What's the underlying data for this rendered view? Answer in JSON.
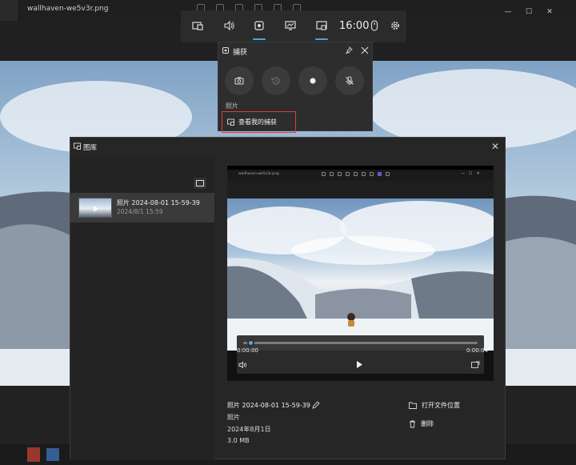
{
  "viewer": {
    "filename": "wallhaven-we5v3r.png",
    "window_controls": [
      "—",
      "☐",
      "✕"
    ]
  },
  "gamebar": {
    "clock": "16:00",
    "widgets": [
      {
        "icon": "widget-menu-icon",
        "active": false
      },
      {
        "icon": "audio-icon",
        "active": false
      },
      {
        "icon": "capture-icon",
        "active": true
      },
      {
        "icon": "performance-icon",
        "active": false
      },
      {
        "icon": "gallery-icon",
        "active": true
      }
    ]
  },
  "capture": {
    "title": "捕获",
    "section_label": "照片",
    "gallery_link": "查看我的捕获"
  },
  "gallery": {
    "title": "图库",
    "items": [
      {
        "name": "照片 2024-08-01 15-59-39",
        "date": "2024/8/1 15:59"
      }
    ],
    "player": {
      "filename": "wallhaven-we5v3r.png",
      "time_start": "0:00:00",
      "time_end": "0:00:04",
      "progress": 0.03
    },
    "details": {
      "name": "照片 2024-08-01 15-59-39",
      "type": "照片",
      "date": "2024年8月1日",
      "size": "3.0 MB"
    },
    "actions": {
      "open_location": "打开文件位置",
      "delete": "删除"
    }
  },
  "colors": {
    "accent": "#4aa3df",
    "highlight_box": "#e03b3b"
  }
}
